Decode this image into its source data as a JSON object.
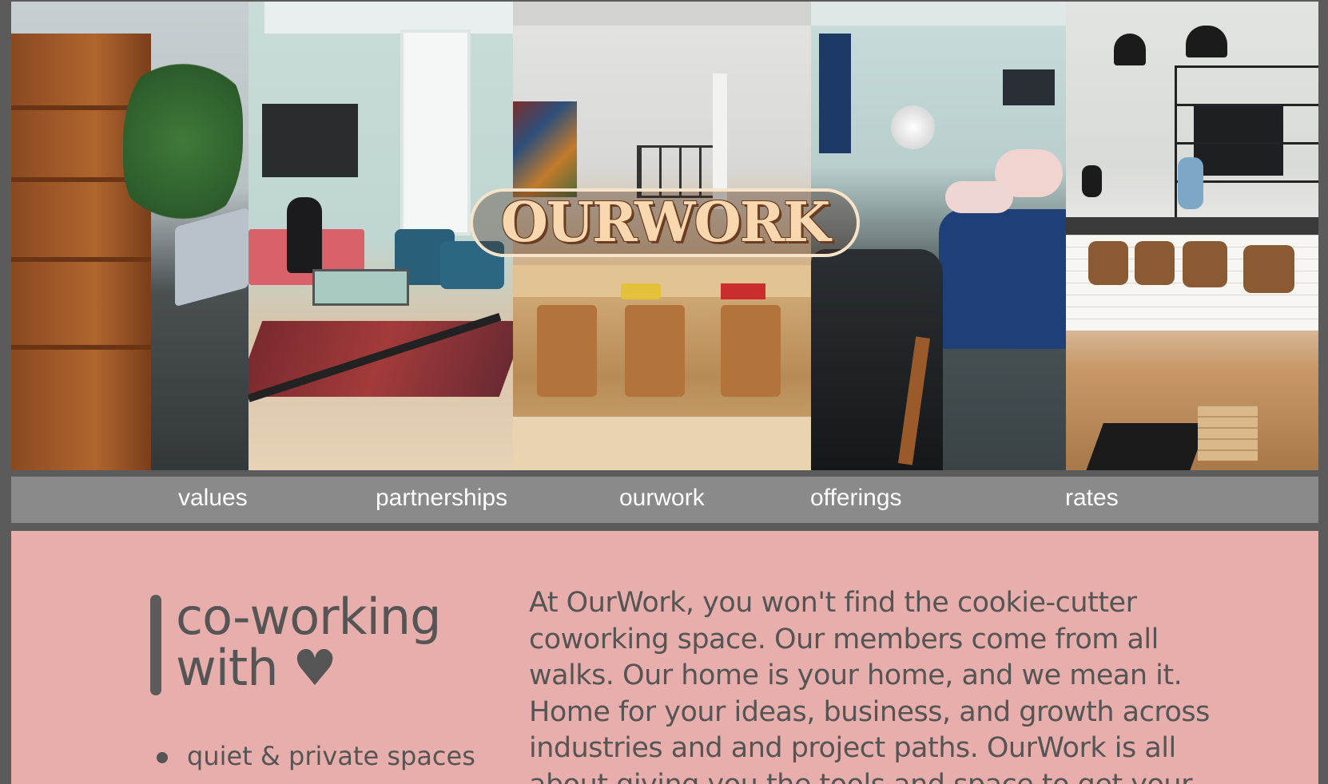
{
  "brand": {
    "logo_text": "OURWORK"
  },
  "nav": {
    "items": [
      {
        "label": "values"
      },
      {
        "label": "partnerships"
      },
      {
        "label": "ourwork"
      },
      {
        "label": "offerings"
      },
      {
        "label": "rates"
      }
    ]
  },
  "intro": {
    "heading_line1": "co-working",
    "heading_line2": "with ♥",
    "features": [
      {
        "label": "quiet & private spaces"
      }
    ],
    "paragraph": "At OurWork, you won't find the cookie-cutter coworking space. Our members come from all walks. Our home is your home, and we mean it. Home for your ideas, business, and growth across industries and and project paths. OurWork is all about giving you the tools and space to get your"
  },
  "colors": {
    "page_frame": "#5b5b5b",
    "nav_background": "#8a8a8a",
    "nav_text": "#ffffff",
    "content_background": "#e8aeac",
    "content_text": "#555555",
    "logo_fill": "#f9d8b0",
    "logo_outline": "#6b3d22"
  }
}
